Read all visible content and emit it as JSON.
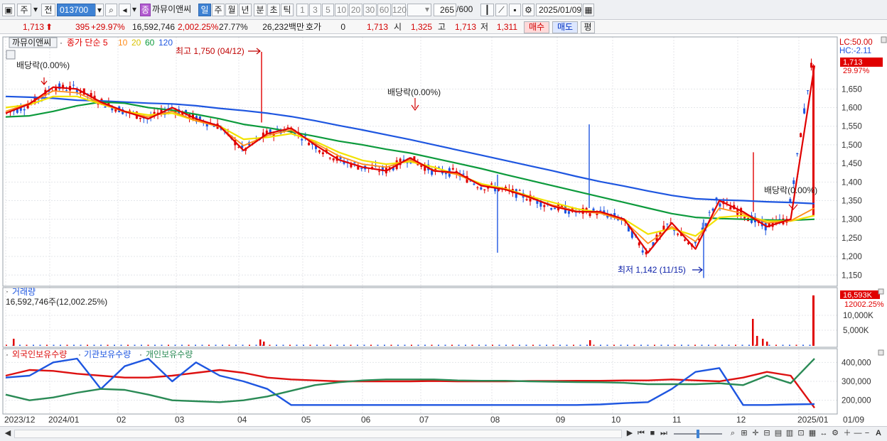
{
  "toolbar": {
    "type_label": "주",
    "prev_label": "전",
    "code_value": "013700",
    "stock_badge": "종",
    "stock_name": "까뮤이앤씨",
    "periods": [
      "일",
      "주",
      "월",
      "년",
      "분",
      "초",
      "틱"
    ],
    "active_period": "일",
    "intervals": [
      "1",
      "3",
      "5",
      "10",
      "20",
      "30",
      "60",
      "120"
    ],
    "bar_count": "265",
    "bar_total": "/600",
    "date_value": "2025/01/09"
  },
  "quote": {
    "price": "1,713",
    "change": "395",
    "change_rate": "+29.97%",
    "volume": "16,592,746",
    "volume_rate": "2,002.25%",
    "turnover": "27.77%",
    "amount": "26,232백만",
    "hoga_label": "호가",
    "hoga_value": "0",
    "current": "1,713",
    "open_label": "시",
    "open": "1,325",
    "high_label": "고",
    "high": "1,713",
    "low_label": "저",
    "low": "1,311",
    "buy_label": "매수",
    "sell_label": "매도",
    "avg_label": "평"
  },
  "legend": {
    "stock_name": "까뮤이앤씨",
    "main": "종가 단순 5",
    "ma": [
      "10",
      "20",
      "60",
      "120"
    ]
  },
  "annotations": {
    "dividend": "배당락(0.00%)",
    "high": "최고 1,750 (04/12)",
    "low": "최저 1,142 (11/15)"
  },
  "right_labels": {
    "lc": "LC:50.00",
    "hc": "HC:-2.11",
    "price_box": "1,713",
    "pct": "29.97%",
    "vol_box": "16,593K",
    "vol_pct": "12002.25%"
  },
  "volume_panel": {
    "title": "거래량",
    "value": "16,592,746주(12,002.25%)"
  },
  "holdings_panel": {
    "foreign": "외국인보유수량",
    "inst": "기관보유수량",
    "indiv": "개인보유수량"
  },
  "chart_data": [
    {
      "type": "line",
      "panel": "price",
      "ylim": [
        1120,
        1790
      ],
      "yticks": [
        1150,
        1200,
        1250,
        1300,
        1350,
        1400,
        1450,
        1500,
        1550,
        1600,
        1650
      ],
      "date_range": [
        "2023-12",
        "2025-01-09"
      ],
      "high": {
        "value": 1750,
        "date": "04/12"
      },
      "low": {
        "value": 1142,
        "date": "11/15"
      },
      "last": 1713,
      "series": [
        {
          "name": "5",
          "color": "#e00000"
        },
        {
          "name": "10",
          "color": "#ff8c1a"
        },
        {
          "name": "20",
          "color": "#f2e200"
        },
        {
          "name": "60",
          "color": "#0c9a3c"
        },
        {
          "name": "120",
          "color": "#1e56e0"
        }
      ],
      "ma_values": {
        "5": [
          1585,
          1610,
          1655,
          1650,
          1615,
          1590,
          1570,
          1600,
          1570,
          1550,
          1485,
          1530,
          1545,
          1500,
          1460,
          1440,
          1430,
          1465,
          1430,
          1425,
          1390,
          1380,
          1360,
          1335,
          1320,
          1320,
          1300,
          1210,
          1290,
          1220,
          1350,
          1320,
          1280,
          1300,
          1713
        ],
        "10": [
          1590,
          1612,
          1645,
          1640,
          1612,
          1588,
          1575,
          1590,
          1565,
          1548,
          1498,
          1525,
          1540,
          1505,
          1470,
          1448,
          1440,
          1460,
          1432,
          1420,
          1392,
          1380,
          1358,
          1338,
          1322,
          1316,
          1296,
          1235,
          1280,
          1240,
          1330,
          1315,
          1290,
          1296,
          1330
        ],
        "20": [
          1600,
          1608,
          1630,
          1630,
          1610,
          1590,
          1580,
          1585,
          1565,
          1550,
          1515,
          1520,
          1530,
          1510,
          1480,
          1458,
          1448,
          1455,
          1440,
          1420,
          1395,
          1382,
          1362,
          1345,
          1328,
          1318,
          1300,
          1260,
          1275,
          1255,
          1305,
          1310,
          1295,
          1295,
          1310
        ],
        "60": [
          1575,
          1578,
          1590,
          1605,
          1615,
          1612,
          1600,
          1593,
          1582,
          1570,
          1555,
          1546,
          1535,
          1523,
          1510,
          1500,
          1488,
          1478,
          1464,
          1450,
          1436,
          1420,
          1405,
          1390,
          1375,
          1360,
          1345,
          1330,
          1315,
          1305,
          1302,
          1300,
          1298,
          1297,
          1300
        ],
        "120": [
          1630,
          1628,
          1625,
          1620,
          1618,
          1615,
          1612,
          1610,
          1605,
          1598,
          1592,
          1585,
          1576,
          1565,
          1552,
          1540,
          1527,
          1514,
          1500,
          1486,
          1472,
          1458,
          1444,
          1430,
          1415,
          1401,
          1389,
          1376,
          1364,
          1355,
          1352,
          1350,
          1347,
          1345,
          1342
        ]
      }
    },
    {
      "type": "bar",
      "panel": "volume",
      "yticks_labels": [
        "5,000K",
        "10,000K"
      ],
      "last": "16,593K"
    },
    {
      "type": "line",
      "panel": "holdings",
      "ylim": [
        150000,
        450000
      ],
      "yticks": [
        200000,
        300000,
        400000
      ],
      "series": [
        {
          "name": "외국인보유수량",
          "color": "#dd1111",
          "values": [
            330000,
            360000,
            355000,
            340000,
            330000,
            320000,
            320000,
            330000,
            345000,
            360000,
            345000,
            320000,
            310000,
            305000,
            300000,
            300000,
            300000,
            300000,
            302000,
            300000,
            300000,
            300000,
            302000,
            302000,
            303000,
            303000,
            305000,
            305000,
            310000,
            305000,
            300000,
            320000,
            350000,
            330000,
            160000
          ]
        },
        {
          "name": "기관보유수량",
          "color": "#1e56e0",
          "values": [
            320000,
            330000,
            400000,
            420000,
            260000,
            380000,
            420000,
            300000,
            400000,
            330000,
            300000,
            260000,
            175000,
            175000,
            175000,
            175000,
            175000,
            175000,
            175000,
            175000,
            175000,
            175000,
            175000,
            175000,
            175000,
            178000,
            185000,
            190000,
            260000,
            350000,
            370000,
            175000,
            175000,
            178000,
            180000
          ]
        },
        {
          "name": "개인보유수량",
          "color": "#2a8a55",
          "values": [
            230000,
            200000,
            215000,
            240000,
            260000,
            255000,
            230000,
            200000,
            195000,
            190000,
            200000,
            220000,
            250000,
            280000,
            295000,
            305000,
            310000,
            310000,
            310000,
            305000,
            303000,
            303000,
            300000,
            298000,
            296000,
            295000,
            292000,
            285000,
            285000,
            285000,
            290000,
            280000,
            330000,
            290000,
            420000
          ]
        }
      ]
    }
  ],
  "axis": {
    "x_labels": [
      "2023/12",
      "2024/01",
      "02",
      "03",
      "04",
      "05",
      "06",
      "07",
      "08",
      "09",
      "10",
      "11",
      "12",
      "2025/01",
      "01/09"
    ]
  },
  "colors": {
    "up": "#e00000",
    "down": "#1e56e0",
    "ma5": "#e00000",
    "ma10": "#ff8c1a",
    "ma20": "#f2e200",
    "ma60": "#0c9a3c",
    "ma120": "#1e56e0",
    "accent": "#3e82d4"
  }
}
